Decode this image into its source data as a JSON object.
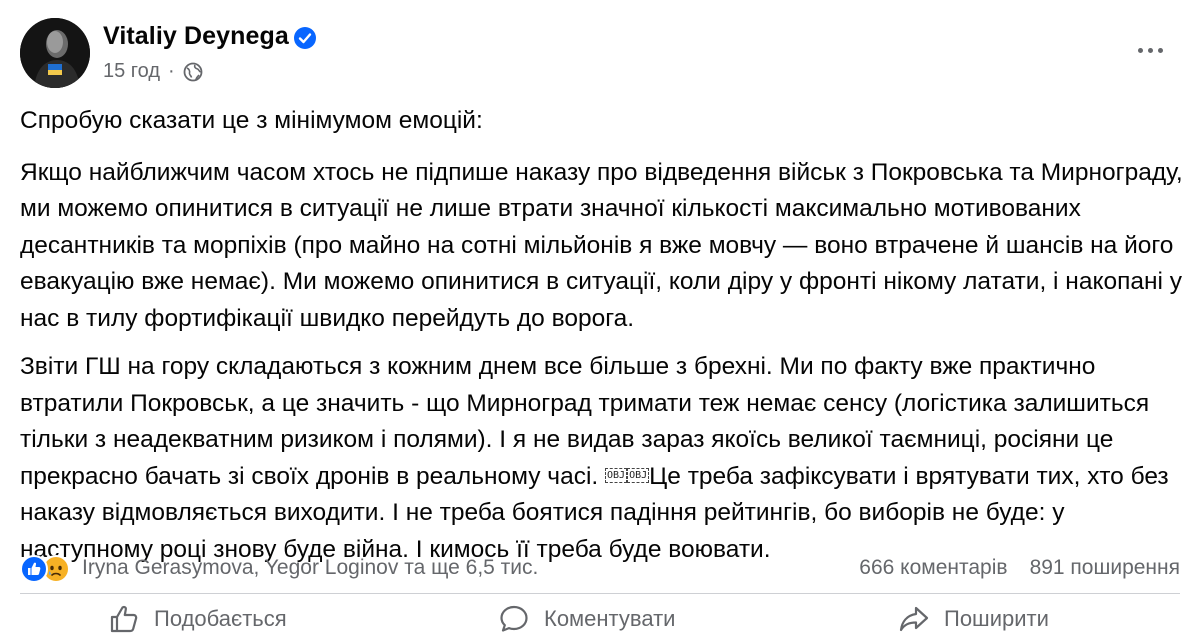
{
  "author": {
    "name": "Vitaliy Deynega",
    "time": "15 год",
    "separator": "·",
    "verified_icon": "verified-badge-icon",
    "privacy_icon": "globe-icon"
  },
  "post": {
    "paragraphs": [
      "Спробую сказати це з мінімумом емоцій:",
      "Якщо найближчим часом хтось не підпише наказу про відведення військ з Покровська та Мирнограду, ми можемо опинитися в ситуації не лише втрати значної кількості максимально мотивованих десантників та морпіхів (про майно на сотні мільйонів я вже мовчу — воно втрачене й шансів на його евакуацію вже немає). Ми можемо опинитися в ситуації, коли діру у фронті нікому латати, і накопані у нас в тилу фортифікації швидко перейдуть до ворога.",
      "Звіти ГШ на гору складаються з кожним днем все більше з брехні. Ми по факту вже практично втратили Покровськ, а це значить - що Мирноград тримати теж немає сенсу (логістика залишиться тільки з неадекватним ризиком і полями). І я не видав зараз якоїсь великої таємниці, росіяни це прекрасно бачать зі своїх дронів в реальному часі."
    ],
    "obj_marker": "OBJ",
    "paragraph_3_tail": "Це треба зафіксувати і врятувати тих, хто без наказу відмовляється виходити. І не треба боятися падіння рейтингів, бо виборів не буде: у наступному році знову буде війна. І кимось її треба буде воювати."
  },
  "reactions": {
    "icons": [
      "like-reaction-icon",
      "sad-reaction-icon"
    ],
    "summary": "Iryna Gerasymova, Yegor Loginov та ще 6,5 тис.",
    "comments": "666 коментарів",
    "shares": "891 поширення"
  },
  "actions": {
    "like": "Подобається",
    "comment": "Коментувати",
    "share": "Поширити"
  },
  "colors": {
    "text": "#050505",
    "secondary": "#65676b",
    "verified": "#0866ff",
    "like": "#0866ff",
    "sad": "#f7b125",
    "divider": "#ced0d4"
  }
}
